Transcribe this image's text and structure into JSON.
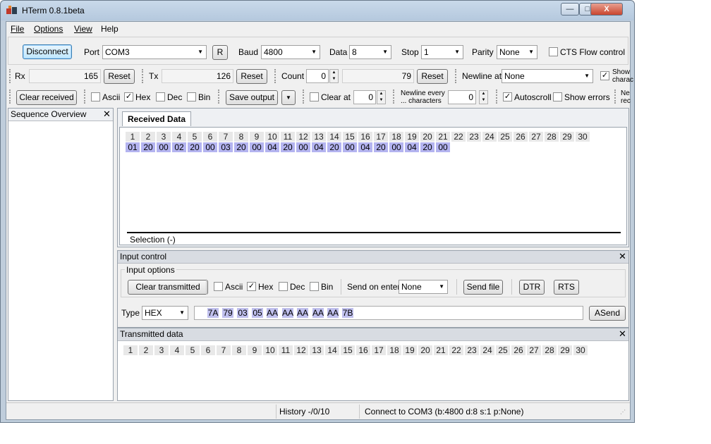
{
  "window": {
    "title": "HTerm 0.8.1beta",
    "controls": {
      "minimize": "—",
      "maximize": "□",
      "close": "X"
    }
  },
  "menu": [
    "File",
    "Options",
    "View",
    "Help"
  ],
  "connection": {
    "disconnect_label": "Disconnect",
    "port_label": "Port",
    "port_value": "COM3",
    "r_label": "R",
    "baud_label": "Baud",
    "baud_value": "4800",
    "data_label": "Data",
    "data_value": "8",
    "stop_label": "Stop",
    "stop_value": "1",
    "parity_label": "Parity",
    "parity_value": "None",
    "cts_label": "CTS Flow control"
  },
  "counters": {
    "rx_label": "Rx",
    "rx_value": "165",
    "rx_reset": "Reset",
    "tx_label": "Tx",
    "tx_value": "126",
    "tx_reset": "Reset",
    "count_label": "Count",
    "count_value": "0",
    "count_total": "79",
    "count_reset": "Reset",
    "newline_label": "Newline at",
    "newline_value": "None",
    "show_label_1": "Show",
    "show_label_2": "charac"
  },
  "display": {
    "clear_received": "Clear received",
    "ascii": "Ascii",
    "hex": "Hex",
    "dec": "Dec",
    "bin": "Bin",
    "save_output": "Save output",
    "clear_at": "Clear at",
    "clear_at_value": "0",
    "newline_every_1": "Newline every",
    "newline_every_2": "... characters",
    "newline_every_value": "0",
    "autoscroll": "Autoscroll",
    "show_errors": "Show errors",
    "ne_1": "Ne",
    "ne_2": "rec"
  },
  "sequence": {
    "title": "Sequence Overview",
    "close": "✕"
  },
  "received": {
    "tab": "Received Data",
    "indices": [
      "1",
      "2",
      "3",
      "4",
      "5",
      "6",
      "7",
      "8",
      "9",
      "10",
      "11",
      "12",
      "13",
      "14",
      "15",
      "16",
      "17",
      "18",
      "19",
      "20",
      "21",
      "22",
      "23",
      "24",
      "25",
      "26",
      "27",
      "28",
      "29",
      "30"
    ],
    "bytes": [
      "01",
      "20",
      "00",
      "02",
      "20",
      "00",
      "03",
      "20",
      "00",
      "04",
      "20",
      "00",
      "04",
      "20",
      "00",
      "04",
      "20",
      "00",
      "04",
      "20",
      "00"
    ],
    "selection": "Selection (-)"
  },
  "input": {
    "title": "Input control",
    "close": "✕",
    "options_label": "Input options",
    "clear_transmitted": "Clear transmitted",
    "ascii": "Ascii",
    "hex": "Hex",
    "dec": "Dec",
    "bin": "Bin",
    "send_on_enter_label": "Send on enter",
    "send_on_enter_value": "None",
    "send_file": "Send file",
    "dtr": "DTR",
    "rts": "RTS",
    "type_label": "Type",
    "type_value": "HEX",
    "tx_bytes": [
      "7A",
      "79",
      "03",
      "05",
      "AA",
      "AA",
      "AA",
      "AA",
      "AA",
      "7B"
    ],
    "asend": "ASend"
  },
  "transmitted": {
    "title": "Transmitted data",
    "close": "✕",
    "indices": [
      "1",
      "2",
      "3",
      "4",
      "5",
      "6",
      "7",
      "8",
      "9",
      "10",
      "11",
      "12",
      "13",
      "14",
      "15",
      "16",
      "17",
      "18",
      "19",
      "20",
      "21",
      "22",
      "23",
      "24",
      "25",
      "26",
      "27",
      "28",
      "29",
      "30"
    ]
  },
  "status": {
    "history": "History -/0/10",
    "connection": "Connect to COM3 (b:4800 d:8 s:1 p:None)"
  }
}
